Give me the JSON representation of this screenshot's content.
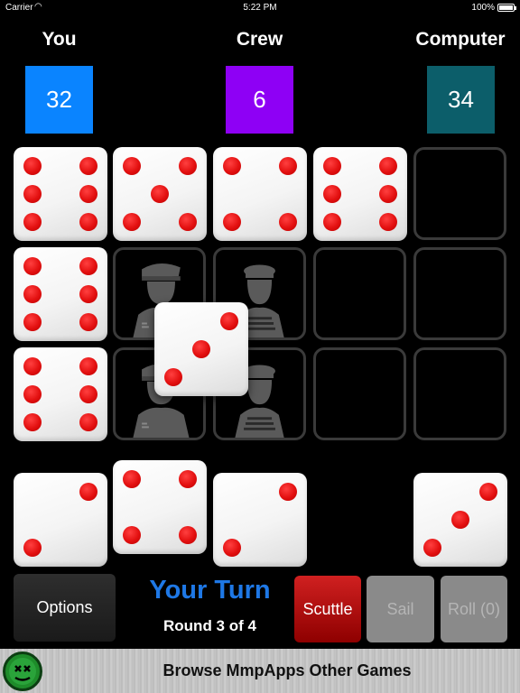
{
  "status_bar": {
    "carrier": "Carrier",
    "time": "5:22 PM",
    "battery": "100%",
    "battery_level": 1.0
  },
  "players": [
    {
      "name": "You",
      "score": "32",
      "color": "#0a84ff"
    },
    {
      "name": "Crew",
      "score": "6",
      "color": "#8e00f5"
    },
    {
      "name": "Computer",
      "score": "34",
      "color": "#0c5e6a"
    }
  ],
  "board": {
    "rows": [
      [
        {
          "die": 6
        },
        {
          "die": 5
        },
        {
          "die": 4
        },
        {
          "die": 6
        },
        {
          "die": null
        }
      ],
      [
        {
          "die": 6
        },
        {
          "crew": "captain-icon"
        },
        {
          "crew": "sailor-icon"
        },
        {
          "die": null
        },
        {
          "die": null
        }
      ],
      [
        {
          "die": 6
        },
        {
          "crew": "captain-icon"
        },
        {
          "crew": "sailor-icon"
        },
        {
          "die": null
        },
        {
          "die": null
        }
      ]
    ],
    "floating_die": 3
  },
  "hand": {
    "you": [
      2,
      4,
      2
    ],
    "computer": [
      3
    ]
  },
  "controls": {
    "options": "Options",
    "turn": "Your Turn",
    "round": "Round 3 of 4",
    "scuttle": "Scuttle",
    "sail": "Sail",
    "roll": "Roll (0)"
  },
  "banner": {
    "text": "Browse MmpApps Other Games",
    "logo": "mmpapps-logo-icon"
  },
  "colors": {
    "pip": "#e31010",
    "turn": "#1e78e6",
    "scuttle": "#b00000",
    "disabled": "#8a8a8a"
  }
}
